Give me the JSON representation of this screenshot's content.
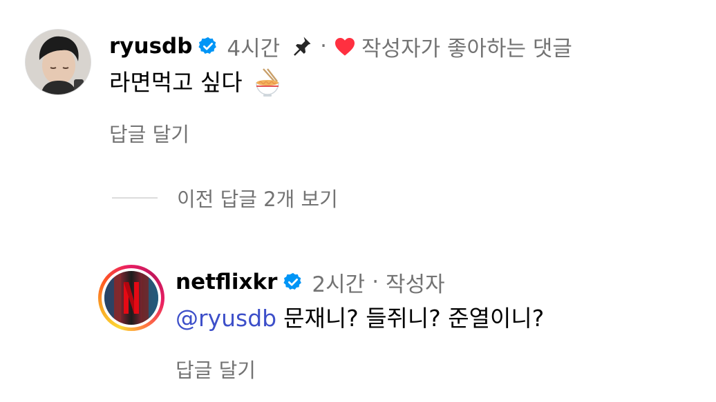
{
  "comment": {
    "username": "ryusdb",
    "time": "4시간",
    "separator": "·",
    "liked_by_author": "작성자가 좋아하는 댓글",
    "text": "라면먹고 싶다",
    "reply_label": "답글 달기",
    "icons": [
      "verified-badge-icon",
      "pin-icon",
      "heart-icon",
      "ramen-bowl-icon"
    ]
  },
  "view_replies": {
    "label": "이전 답글 2개 보기"
  },
  "reply": {
    "username": "netflixkr",
    "time": "2시간",
    "separator": "·",
    "author_badge": "작성자",
    "mention": "@ryusdb",
    "text": "문재니? 들쥐니? 준열이니?",
    "reply_label": "답글 달기",
    "avatar_logo": "N"
  },
  "colors": {
    "verified": "#0095f6",
    "heart": "#ff3040",
    "mention": "#3d4fc9",
    "muted": "#737373",
    "netflix_red": "#e50914"
  }
}
